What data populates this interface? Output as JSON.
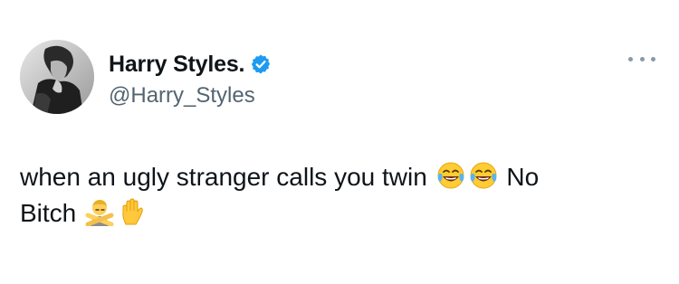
{
  "tweet": {
    "display_name": "Harry Styles.",
    "handle": "@Harry_Styles",
    "verified": true,
    "text_line1": "when an ugly stranger calls you twin",
    "text_after_emojis": "No",
    "text_line2": "Bitch",
    "emojis": [
      "face-with-tears-of-joy-emoji",
      "face-with-tears-of-joy-emoji",
      "person-gesturing-no-emoji",
      "raised-hand-emoji"
    ]
  },
  "colors": {
    "text": "#0f1419",
    "secondary": "#536471",
    "verified_badge": "#1d9bf0",
    "more_dots": "#8b98a5"
  },
  "icons": {
    "verified": "verified-badge-icon",
    "more": "more-options-icon"
  }
}
